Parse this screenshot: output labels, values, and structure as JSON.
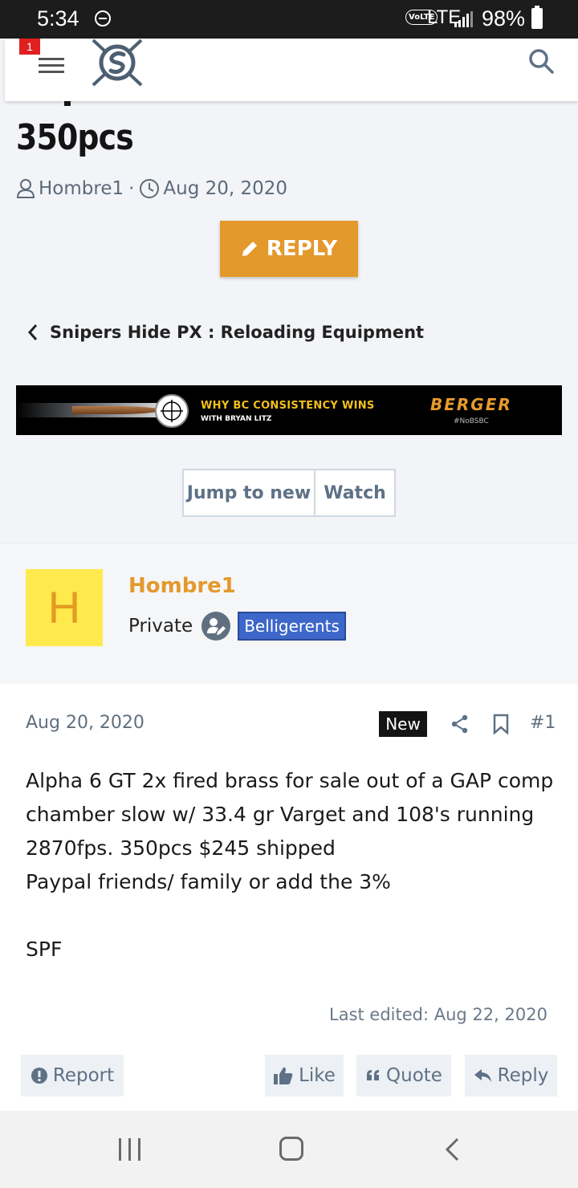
{
  "status_bar": {
    "time": "5:34",
    "network_badge": "VoLTE",
    "network": "LTE",
    "battery": "98%"
  },
  "header": {
    "notification_count": "1",
    "icons": [
      "menu-icon",
      "site-logo",
      "search-icon"
    ]
  },
  "thread": {
    "title": "350pcs",
    "author": "Hombre1",
    "date": "Aug 20, 2020",
    "reply_label": "REPLY",
    "breadcrumb": "Snipers Hide PX : Reloading Equipment"
  },
  "banner": {
    "headline": "WHY BC CONSISTENCY WINS",
    "subline": "WITH BRYAN LITZ",
    "brand": "BERGER",
    "hashtag": "#NoBSBC"
  },
  "thread_buttons": {
    "jump_label": "Jump to new",
    "watch_label": "Watch"
  },
  "post": {
    "avatar_letter": "H",
    "username": "Hombre1",
    "rank": "Private",
    "group": "Belligerents",
    "date": "Aug 20, 2020",
    "new_label": "New",
    "number": "#1",
    "lines": [
      "Alpha 6 GT 2x fired brass for sale out of a GAP comp",
      "chamber slow w/ 33.4 gr Varget and 108's running",
      "2870fps. 350pcs $245 shipped",
      "Paypal friends/ family or add the 3%",
      "",
      "SPF"
    ],
    "last_edited": "Last edited: Aug 22, 2020",
    "actions": {
      "report": "Report",
      "like": "Like",
      "quote": "Quote",
      "reply": "Reply"
    }
  },
  "colors": {
    "accent": "#e3992c",
    "group_badge": "#3d67c9",
    "muted_text": "#5e7186"
  }
}
